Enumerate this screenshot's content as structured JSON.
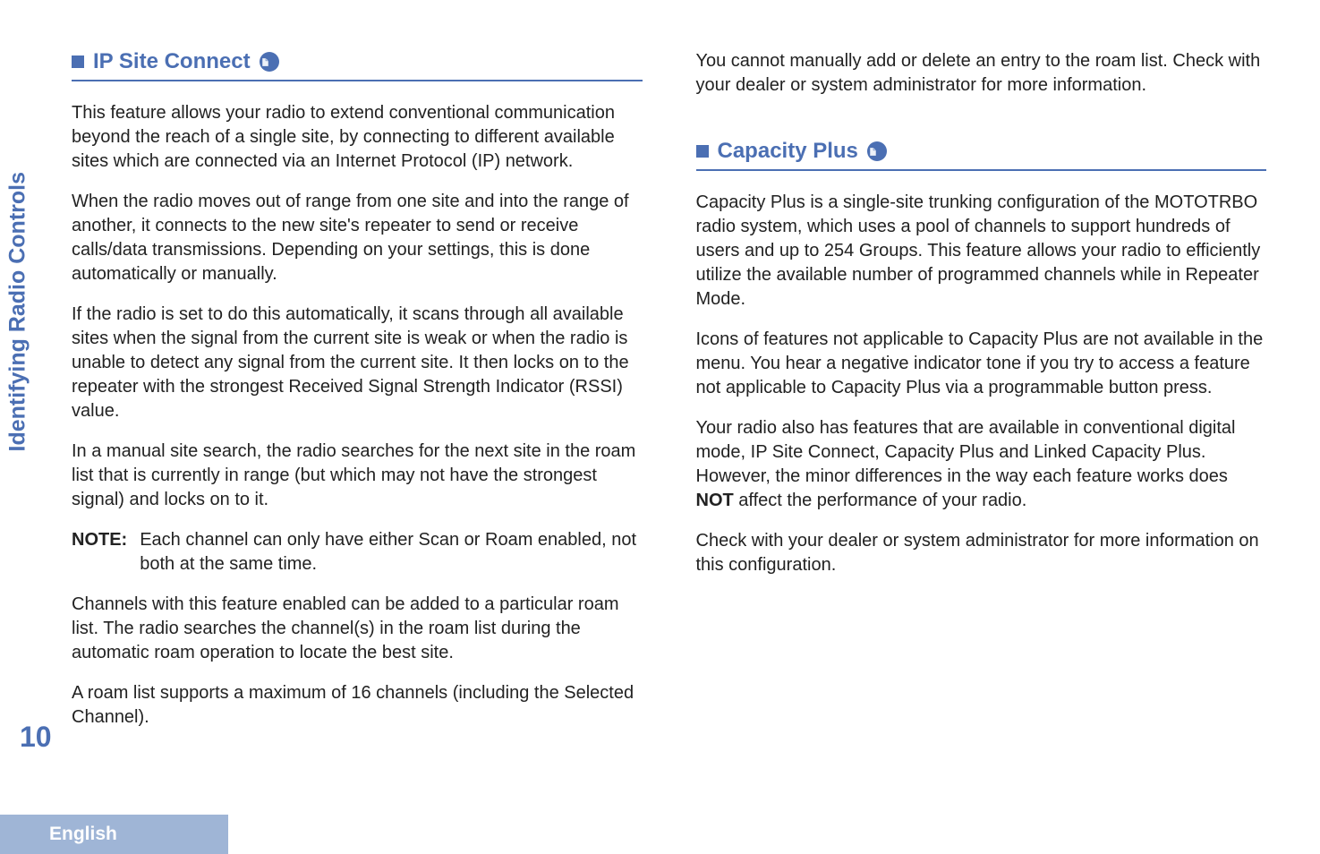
{
  "sidebar": {
    "section_label": "Identifying Radio Controls",
    "page_number": "10",
    "language": "English"
  },
  "left_column": {
    "heading1": "IP Site Connect",
    "p1": "This feature allows your radio to extend conventional communication beyond the reach of a single site, by connecting to different available sites which are connected via an Internet Protocol (IP) network.",
    "p2": "When the radio moves out of range from one site and into the range of another, it connects to the new site's repeater to send or receive calls/data transmissions. Depending on your settings, this is done automatically or manually.",
    "p3": "If the radio is set to do this automatically, it scans through all available sites when the signal from the current site is weak or when the radio is unable to detect any signal from the current site. It then locks on to the repeater with the strongest Received Signal Strength Indicator (RSSI) value.",
    "p4": "In a manual site search, the radio searches for the next site in the roam list that is currently in range (but which may not have the strongest signal) and locks on to it.",
    "note_label": "NOTE:",
    "note_text": "Each channel can only have either Scan or Roam enabled, not both at the same time.",
    "p5": "Channels with this feature enabled can be added to a particular roam list. The radio searches the channel(s) in the roam list during the automatic roam operation to locate the best site.",
    "p6": "A roam list supports a maximum of 16 channels (including the Selected Channel)."
  },
  "right_column": {
    "p_top": "You cannot manually add or delete an entry to the roam list. Check with your dealer or system administrator for more information.",
    "heading2": "Capacity Plus",
    "p1": "Capacity Plus is a single-site trunking configuration of the MOTOTRBO radio system, which uses a pool of channels to support hundreds of users and up to 254 Groups. This feature allows your radio to efficiently utilize the available number of programmed channels while in Repeater Mode.",
    "p2": "Icons of features not applicable to Capacity Plus are not available in the menu. You hear a negative indicator tone if you try to access a feature not applicable to Capacity Plus via a programmable button press.",
    "p3_pre": "Your radio also has features that are available in conventional digital mode, IP Site Connect, Capacity Plus and Linked Capacity Plus. However, the minor differences in the way each feature works does ",
    "p3_bold": "NOT",
    "p3_post": " affect the performance of your radio.",
    "p4": "Check with your dealer or system administrator for more information on this configuration."
  }
}
